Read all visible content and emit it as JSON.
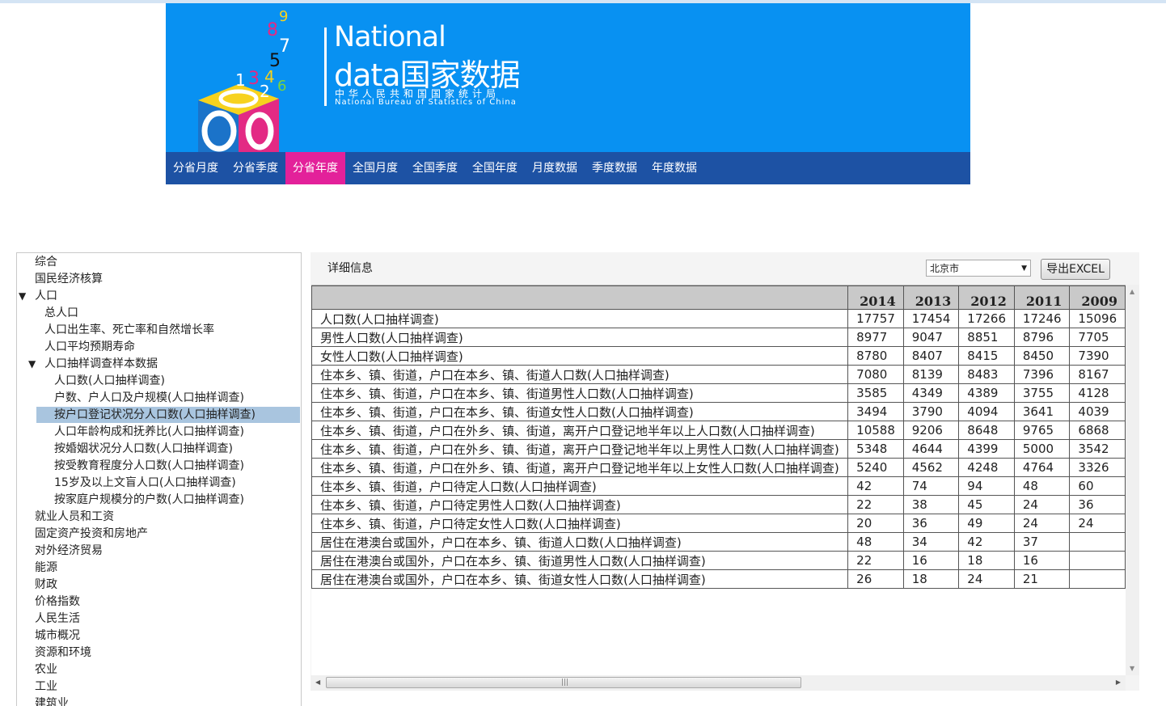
{
  "banner": {
    "logo_en_line1": "National",
    "logo_en_line2": "data国家数据",
    "logo_cn_sub": "中华人民共和国国家统计局",
    "logo_en_sub": "National Bureau of Statistics of China",
    "digits": [
      "8",
      "9",
      "7",
      "5",
      "1",
      "3",
      "4",
      "6",
      "2"
    ]
  },
  "nav": [
    {
      "label": "分省月度",
      "active": false
    },
    {
      "label": "分省季度",
      "active": false
    },
    {
      "label": "分省年度",
      "active": true
    },
    {
      "label": "全国月度",
      "active": false
    },
    {
      "label": "全国季度",
      "active": false
    },
    {
      "label": "全国年度",
      "active": false
    },
    {
      "label": "月度数据",
      "active": false
    },
    {
      "label": "季度数据",
      "active": false
    },
    {
      "label": "年度数据",
      "active": false
    }
  ],
  "tree": [
    {
      "label": "综合",
      "level": 0,
      "expanded": null,
      "selected": false
    },
    {
      "label": "国民经济核算",
      "level": 0,
      "expanded": null,
      "selected": false
    },
    {
      "label": "人口",
      "level": 0,
      "expanded": true,
      "selected": false
    },
    {
      "label": "总人口",
      "level": 1,
      "expanded": null,
      "selected": false
    },
    {
      "label": "人口出生率、死亡率和自然增长率",
      "level": 1,
      "expanded": null,
      "selected": false
    },
    {
      "label": "人口平均预期寿命",
      "level": 1,
      "expanded": null,
      "selected": false
    },
    {
      "label": "人口抽样调查样本数据",
      "level": 1,
      "expanded": true,
      "selected": false
    },
    {
      "label": "人口数(人口抽样调查)",
      "level": 2,
      "expanded": null,
      "selected": false
    },
    {
      "label": "户数、户人口及户规模(人口抽样调查)",
      "level": 2,
      "expanded": null,
      "selected": false
    },
    {
      "label": "按户口登记状况分人口数(人口抽样调查)",
      "level": 2,
      "expanded": null,
      "selected": true
    },
    {
      "label": "人口年龄构成和抚养比(人口抽样调查)",
      "level": 2,
      "expanded": null,
      "selected": false
    },
    {
      "label": "按婚姻状况分人口数(人口抽样调查)",
      "level": 2,
      "expanded": null,
      "selected": false
    },
    {
      "label": "按受教育程度分人口数(人口抽样调查)",
      "level": 2,
      "expanded": null,
      "selected": false
    },
    {
      "label": "15岁及以上文盲人口(人口抽样调查)",
      "level": 2,
      "expanded": null,
      "selected": false
    },
    {
      "label": "按家庭户规模分的户数(人口抽样调查)",
      "level": 2,
      "expanded": null,
      "selected": false
    },
    {
      "label": "就业人员和工资",
      "level": 0,
      "expanded": null,
      "selected": false
    },
    {
      "label": "固定资产投资和房地产",
      "level": 0,
      "expanded": null,
      "selected": false
    },
    {
      "label": "对外经济贸易",
      "level": 0,
      "expanded": null,
      "selected": false
    },
    {
      "label": "能源",
      "level": 0,
      "expanded": null,
      "selected": false
    },
    {
      "label": "财政",
      "level": 0,
      "expanded": null,
      "selected": false
    },
    {
      "label": "价格指数",
      "level": 0,
      "expanded": null,
      "selected": false
    },
    {
      "label": "人民生活",
      "level": 0,
      "expanded": null,
      "selected": false
    },
    {
      "label": "城市概况",
      "level": 0,
      "expanded": null,
      "selected": false
    },
    {
      "label": "资源和环境",
      "level": 0,
      "expanded": null,
      "selected": false
    },
    {
      "label": "农业",
      "level": 0,
      "expanded": null,
      "selected": false
    },
    {
      "label": "工业",
      "level": 0,
      "expanded": null,
      "selected": false
    },
    {
      "label": "建筑业",
      "level": 0,
      "expanded": null,
      "selected": false
    }
  ],
  "panel": {
    "title": "详细信息",
    "region": "北京市",
    "export_label": "导出EXCEL"
  },
  "table": {
    "years": [
      "2014",
      "2013",
      "2012",
      "2011",
      "2009"
    ],
    "rows": [
      {
        "name": "人口数(人口抽样调查)",
        "values": [
          "17757",
          "17454",
          "17266",
          "17246",
          "15096"
        ]
      },
      {
        "name": "男性人口数(人口抽样调查)",
        "values": [
          "8977",
          "9047",
          "8851",
          "8796",
          "7705"
        ]
      },
      {
        "name": "女性人口数(人口抽样调查)",
        "values": [
          "8780",
          "8407",
          "8415",
          "8450",
          "7390"
        ]
      },
      {
        "name": "住本乡、镇、街道，户口在本乡、镇、街道人口数(人口抽样调查)",
        "values": [
          "7080",
          "8139",
          "8483",
          "7396",
          "8167"
        ]
      },
      {
        "name": "住本乡、镇、街道，户口在本乡、镇、街道男性人口数(人口抽样调查)",
        "values": [
          "3585",
          "4349",
          "4389",
          "3755",
          "4128"
        ]
      },
      {
        "name": "住本乡、镇、街道，户口在本乡、镇、街道女性人口数(人口抽样调查)",
        "values": [
          "3494",
          "3790",
          "4094",
          "3641",
          "4039"
        ]
      },
      {
        "name": "住本乡、镇、街道，户口在外乡、镇、街道，离开户口登记地半年以上人口数(人口抽样调查)",
        "values": [
          "10588",
          "9206",
          "8648",
          "9765",
          "6868"
        ]
      },
      {
        "name": "住本乡、镇、街道，户口在外乡、镇、街道，离开户口登记地半年以上男性人口数(人口抽样调查)",
        "values": [
          "5348",
          "4644",
          "4399",
          "5000",
          "3542"
        ]
      },
      {
        "name": "住本乡、镇、街道，户口在外乡、镇、街道，离开户口登记地半年以上女性人口数(人口抽样调查)",
        "values": [
          "5240",
          "4562",
          "4248",
          "4764",
          "3326"
        ]
      },
      {
        "name": "住本乡、镇、街道，户口待定人口数(人口抽样调查)",
        "values": [
          "42",
          "74",
          "94",
          "48",
          "60"
        ]
      },
      {
        "name": "住本乡、镇、街道，户口待定男性人口数(人口抽样调查)",
        "values": [
          "22",
          "38",
          "45",
          "24",
          "36"
        ]
      },
      {
        "name": "住本乡、镇、街道，户口待定女性人口数(人口抽样调查)",
        "values": [
          "20",
          "36",
          "49",
          "24",
          "24"
        ]
      },
      {
        "name": "居住在港澳台或国外，户口在本乡、镇、街道人口数(人口抽样调查)",
        "values": [
          "48",
          "34",
          "42",
          "37",
          ""
        ]
      },
      {
        "name": "居住在港澳台或国外，户口在本乡、镇、街道男性人口数(人口抽样调查)",
        "values": [
          "22",
          "16",
          "18",
          "16",
          ""
        ]
      },
      {
        "name": "居住在港澳台或国外，户口在本乡、镇、街道女性人口数(人口抽样调查)",
        "values": [
          "26",
          "18",
          "24",
          "21",
          ""
        ]
      }
    ]
  },
  "icons": {
    "tree_expanded": "triangle-down-icon",
    "select_arrow": "caret-down-icon",
    "scroll_up": "arrow-up-icon",
    "scroll_down": "arrow-down-icon",
    "scroll_left": "arrow-left-icon",
    "scroll_right": "arrow-right-icon"
  },
  "colors": {
    "banner_bg": "#0891f2",
    "nav_bg": "#1d52a4",
    "nav_active": "#e3219a",
    "tree_selected": "#a9c5df",
    "table_header": "#c9c9c9"
  }
}
